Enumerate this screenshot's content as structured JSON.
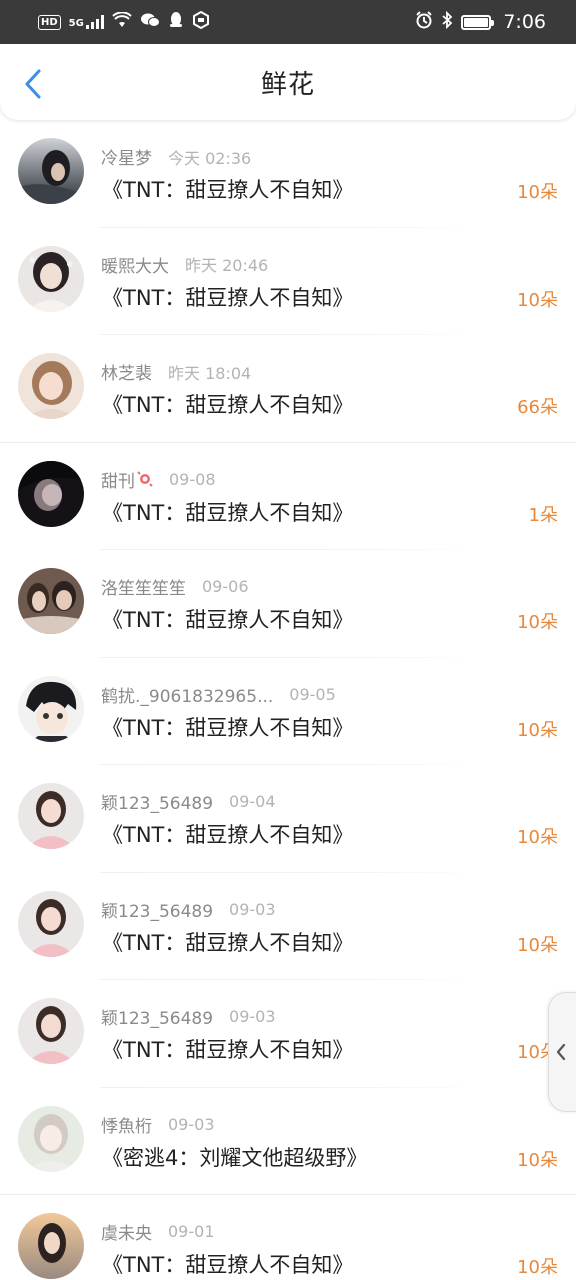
{
  "status_bar": {
    "hd": "HD",
    "net": "5G",
    "time": "7:06",
    "icons": [
      "hd-icon",
      "signal-icon",
      "wifi-icon",
      "wechat-icon",
      "qq-icon",
      "app-icon",
      "alarm-icon",
      "bluetooth-icon",
      "battery-icon"
    ]
  },
  "header": {
    "title": "鲜花",
    "back_icon": "chevron-left-icon",
    "accent": "#3a8ee6"
  },
  "colors": {
    "count": "#e8883a",
    "meta": "#8a8a8a",
    "date": "#b3b3b3"
  },
  "items": [
    {
      "name": "冷星梦",
      "date": "今天 02:36",
      "book": "《TNT：甜豆撩人不自知》",
      "count": "10朵"
    },
    {
      "name": "暖熙大大",
      "date": "昨天 20:46",
      "book": "《TNT：甜豆撩人不自知》",
      "count": "10朵"
    },
    {
      "name": "林芝裴",
      "date": "昨天 18:04",
      "book": "《TNT：甜豆撩人不自知》",
      "count": "66朵"
    },
    {
      "name": "甜刊",
      "date": "09-08",
      "book": "《TNT：甜豆撩人不自知》",
      "count": "1朵"
    },
    {
      "name": "洛笙笙笙笙",
      "date": "09-06",
      "book": "《TNT：甜豆撩人不自知》",
      "count": "10朵"
    },
    {
      "name": "鹤扰._9061832965...",
      "date": "09-05",
      "book": "《TNT：甜豆撩人不自知》",
      "count": "10朵"
    },
    {
      "name": "颖123_56489",
      "date": "09-04",
      "book": "《TNT：甜豆撩人不自知》",
      "count": "10朵"
    },
    {
      "name": "颖123_56489",
      "date": "09-03",
      "book": "《TNT：甜豆撩人不自知》",
      "count": "10朵"
    },
    {
      "name": "颖123_56489",
      "date": "09-03",
      "book": "《TNT：甜豆撩人不自知》",
      "count": "10朵"
    },
    {
      "name": "悸魚桁",
      "date": "09-03",
      "book": "《密逃4：刘耀文他超级野》",
      "count": "10朵"
    },
    {
      "name": "虞未央",
      "date": "09-01",
      "book": "《TNT：甜豆撩人不自知》",
      "count": "10朵"
    }
  ],
  "side_tab": {
    "icon": "chevron-left-icon"
  }
}
